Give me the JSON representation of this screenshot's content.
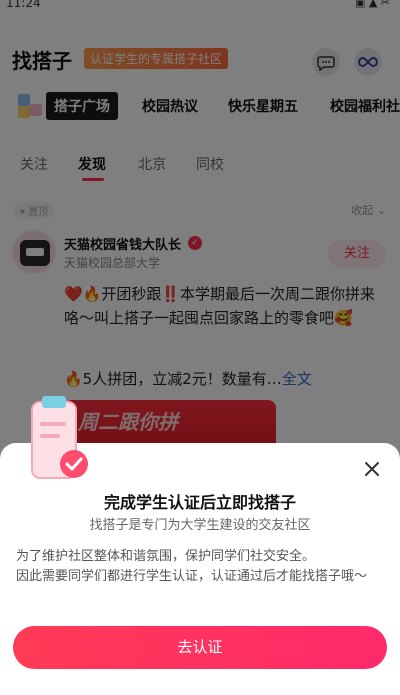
{
  "status_bar": {
    "time": "11:24",
    "icons": "▣ ▲ ✂"
  },
  "header": {
    "title": "找搭子",
    "tag": "认证学生的专属搭子社区",
    "chat_icon": "chat-bubble-icon",
    "loop_icon": "infinity-icon"
  },
  "channels": [
    "搭子广场",
    "校园热议",
    "快乐星期五",
    "校园福利社"
  ],
  "feed_tabs": [
    "关注",
    "发现",
    "北京",
    "同校"
  ],
  "feed": {
    "meta": "▾ 置顶",
    "collapse_label": "收起 ⌄"
  },
  "post": {
    "author": "天猫校园省钱大队长",
    "school": "天猫校园总部大学",
    "follow_label": "关注",
    "body": "❤️🔥开团秒跟‼️本学期最后一次周二跟你拼来咯～叫上搭子一起囤点回家路上的零食吧🥰",
    "line2": "🔥5人拼团，立减2元！数量有…",
    "full_text_link": "全文",
    "banner_text": "周二跟你拼"
  },
  "sheet": {
    "title": "完成学生认证后立即找搭子",
    "subtitle": "找搭子是专门为大学生建设的交友社区",
    "desc_line1": "为了维护社区整体和谐氛围，保护同学们社交安全。",
    "desc_line2": "因此需要同学们都进行学生认证，认证通过后才能找搭子哦～",
    "cta_label": "去认证"
  },
  "colors": {
    "accent": "#ff2e4d",
    "overlay": "#00000080"
  }
}
